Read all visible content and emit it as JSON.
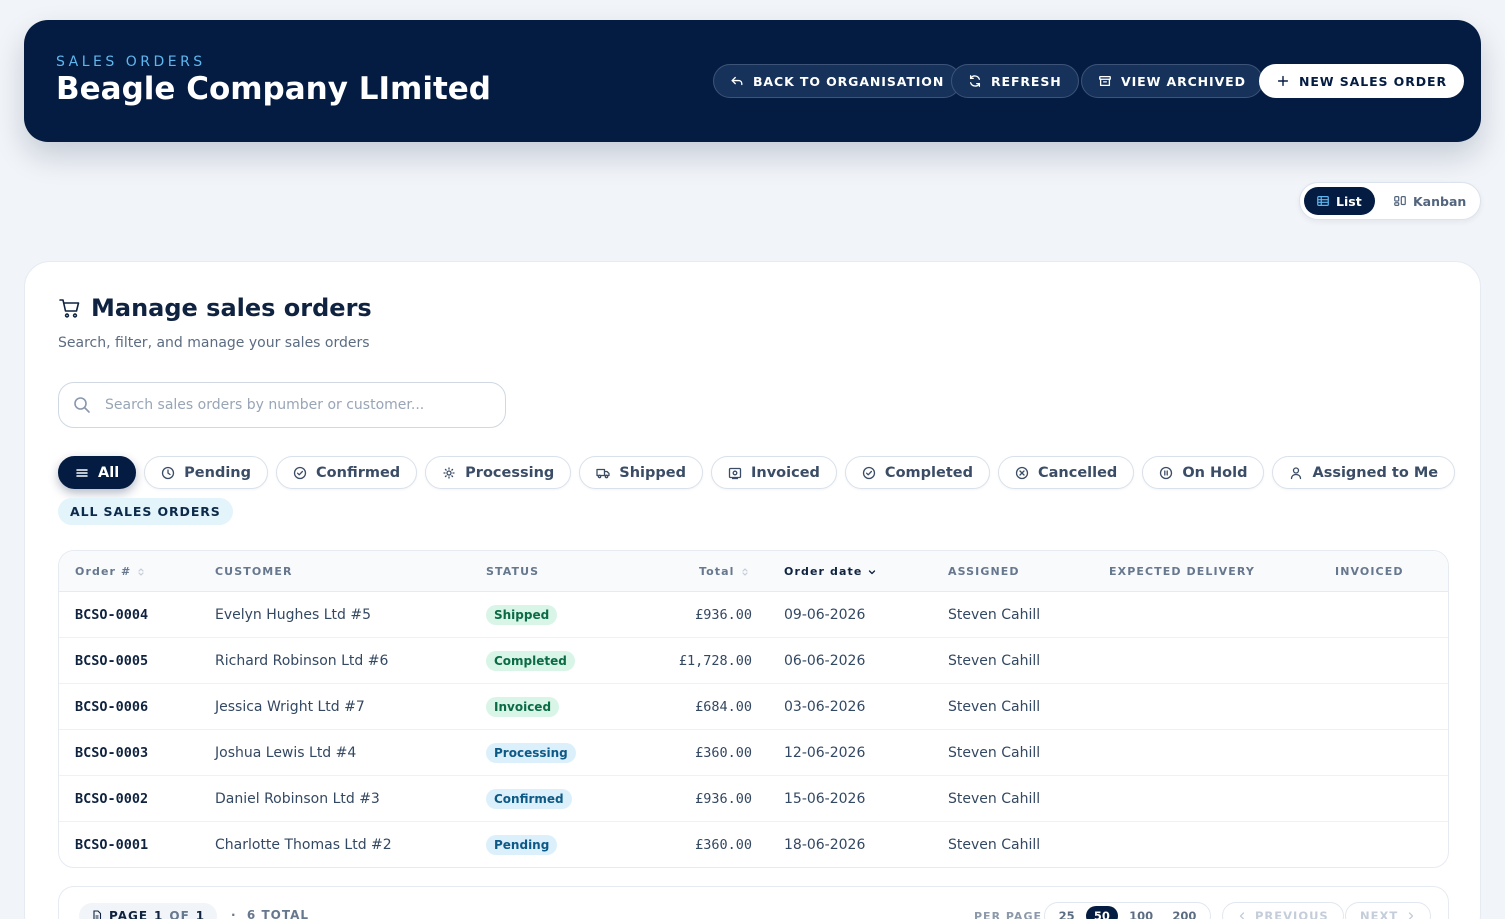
{
  "header": {
    "eyebrow": "SALES ORDERS",
    "company": "Beagle Company LImited",
    "buttons": {
      "back": "BACK TO ORGANISATION",
      "refresh": "REFRESH",
      "archived": "VIEW ARCHIVED",
      "new": "NEW SALES ORDER"
    }
  },
  "view_switch": {
    "list": "List",
    "kanban": "Kanban",
    "active": "List"
  },
  "card": {
    "title": "Manage sales orders",
    "subtitle": "Search, filter, and manage your sales orders",
    "search_placeholder": "Search sales orders by number or customer..."
  },
  "filters": [
    "All",
    "Pending",
    "Confirmed",
    "Processing",
    "Shipped",
    "Invoiced",
    "Completed",
    "Cancelled",
    "On Hold",
    "Assigned to Me"
  ],
  "active_filter": "All",
  "filter_badge": "ALL SALES ORDERS",
  "table": {
    "columns": [
      "Order #",
      "CUSTOMER",
      "STATUS",
      "Total",
      "Order date",
      "ASSIGNED",
      "EXPECTED DELIVERY",
      "INVOICED"
    ],
    "rows": [
      {
        "number": "BCSO-0004",
        "customer": "Evelyn Hughes Ltd #5",
        "status": "Shipped",
        "total": "£936.00",
        "date": "09-06-2026",
        "assigned": "Steven Cahill",
        "expected": "",
        "invoiced": ""
      },
      {
        "number": "BCSO-0005",
        "customer": "Richard Robinson Ltd #6",
        "status": "Completed",
        "total": "£1,728.00",
        "date": "06-06-2026",
        "assigned": "Steven Cahill",
        "expected": "",
        "invoiced": ""
      },
      {
        "number": "BCSO-0006",
        "customer": "Jessica Wright Ltd #7",
        "status": "Invoiced",
        "total": "£684.00",
        "date": "03-06-2026",
        "assigned": "Steven Cahill",
        "expected": "",
        "invoiced": ""
      },
      {
        "number": "BCSO-0003",
        "customer": "Joshua Lewis Ltd #4",
        "status": "Processing",
        "total": "£360.00",
        "date": "12-06-2026",
        "assigned": "Steven Cahill",
        "expected": "",
        "invoiced": ""
      },
      {
        "number": "BCSO-0002",
        "customer": "Daniel Robinson Ltd #3",
        "status": "Confirmed",
        "total": "£936.00",
        "date": "15-06-2026",
        "assigned": "Steven Cahill",
        "expected": "",
        "invoiced": ""
      },
      {
        "number": "BCSO-0001",
        "customer": "Charlotte Thomas Ltd #2",
        "status": "Pending",
        "total": "£360.00",
        "date": "18-06-2026",
        "assigned": "Steven Cahill",
        "expected": "",
        "invoiced": ""
      }
    ]
  },
  "status_colors": {
    "Shipped": {
      "bg": "#d8f5e8",
      "fg": "#0b6b45"
    },
    "Completed": {
      "bg": "#d8f5e8",
      "fg": "#0b6b45"
    },
    "Invoiced": {
      "bg": "#d8f5e8",
      "fg": "#0b6b45"
    },
    "Processing": {
      "bg": "#dcf0fb",
      "fg": "#0d5a86"
    },
    "Confirmed": {
      "bg": "#dcf0fb",
      "fg": "#0d5a86"
    },
    "Pending": {
      "bg": "#dcf0fb",
      "fg": "#0d5a86"
    }
  },
  "pagination": {
    "page_label": "PAGE",
    "page": "1",
    "of_label": "OF",
    "pages": "1",
    "total": "6 TOTAL",
    "per_page_label": "PER PAGE",
    "per_page_options": [
      "25",
      "50",
      "100",
      "200"
    ],
    "per_page_selected": "50",
    "previous": "PREVIOUS",
    "next": "NEXT"
  },
  "colors": {
    "navy": "#041c42",
    "accent": "#5fb6ee"
  }
}
